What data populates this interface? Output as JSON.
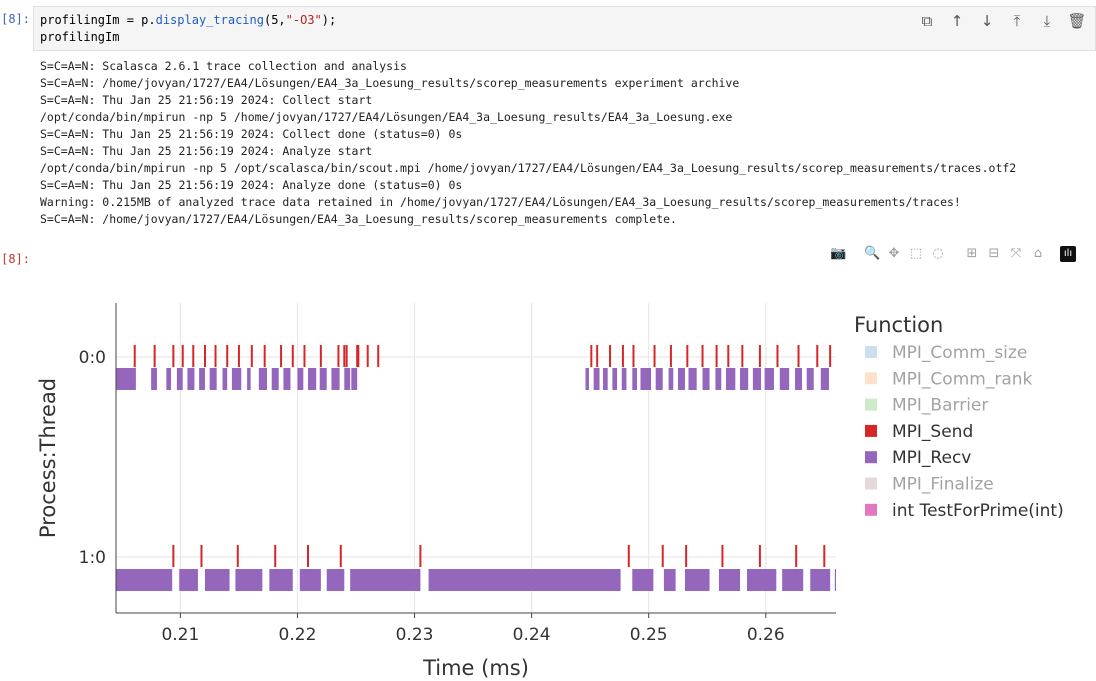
{
  "cell": {
    "in_prompt": "[8]:",
    "out_prompt": "[8]:",
    "code_line1_a": "profilingIm = p.",
    "code_line1_fn": "display_tracing",
    "code_line1_b": "(5,",
    "code_line1_str": "\"-O3\"",
    "code_line1_c": ");",
    "code_line2": "profilingIm"
  },
  "toolbar": {
    "copy_icon": "⧉",
    "move_up_icon": "↑",
    "move_down_icon": "↓",
    "insert_above_icon": "⤒",
    "insert_below_icon": "⤓",
    "delete_icon": "🗑"
  },
  "output_lines": [
    "S=C=A=N: Scalasca 2.6.1 trace collection and analysis",
    "S=C=A=N: /home/jovyan/1727/EA4/Lösungen/EA4_3a_Loesung_results/scorep_measurements experiment archive",
    "S=C=A=N: Thu Jan 25 21:56:19 2024: Collect start",
    "/opt/conda/bin/mpirun -np 5 /home/jovyan/1727/EA4/Lösungen/EA4_3a_Loesung_results/EA4_3a_Loesung.exe",
    "S=C=A=N: Thu Jan 25 21:56:19 2024: Collect done (status=0) 0s",
    "S=C=A=N: Thu Jan 25 21:56:19 2024: Analyze start",
    "/opt/conda/bin/mpirun -np 5 /opt/scalasca/bin/scout.mpi /home/jovyan/1727/EA4/Lösungen/EA4_3a_Loesung_results/scorep_measurements/traces.otf2",
    "S=C=A=N: Thu Jan 25 21:56:19 2024: Analyze done (status=0) 0s",
    "Warning: 0.215MB of analyzed trace data retained in /home/jovyan/1727/EA4/Lösungen/EA4_3a_Loesung_results/scorep_measurements/traces!",
    "S=C=A=N: /home/jovyan/1727/EA4/Lösungen/EA4_3a_Loesung_results/scorep_measurements complete."
  ],
  "modebar": {
    "camera_icon": "📷",
    "zoom_icon": "🔍",
    "pan_icon": "✥",
    "box_select_icon": "⬚",
    "lasso_icon": "◌",
    "zoom_in_icon": "⊞",
    "zoom_out_icon": "⊟",
    "autoscale_icon": "⤧",
    "reset_icon": "⌂",
    "plotly_logo": "ılı"
  },
  "chart_data": {
    "type": "timeline",
    "xlabel": "Time (ms)",
    "ylabel": "Process:Thread",
    "xlim": [
      0.2045,
      0.266
    ],
    "x_ticks": [
      0.21,
      0.22,
      0.23,
      0.24,
      0.25,
      0.26
    ],
    "x_tick_labels": [
      "0.21",
      "0.22",
      "0.23",
      "0.24",
      "0.25",
      "0.26"
    ],
    "rows": [
      "0:0",
      "1:0"
    ],
    "grid": true,
    "legend": {
      "title": "Function",
      "position": "right",
      "entries": [
        {
          "name": "MPI_Comm_size",
          "color": "#8db8dc",
          "visible": false
        },
        {
          "name": "MPI_Comm_rank",
          "color": "#ffbb88",
          "visible": false
        },
        {
          "name": "MPI_Barrier",
          "color": "#90d08a",
          "visible": false
        },
        {
          "name": "MPI_Send",
          "color": "#d62728",
          "visible": true
        },
        {
          "name": "MPI_Recv",
          "color": "#9467bd",
          "visible": true
        },
        {
          "name": "MPI_Finalize",
          "color": "#c9aba6",
          "visible": false
        },
        {
          "name": "int TestForPrime(int)",
          "color": "#e377c2",
          "visible": true
        }
      ]
    },
    "send_events": {
      "0:0": [
        0.2061,
        0.2078,
        0.2094,
        0.2102,
        0.2111,
        0.2121,
        0.213,
        0.214,
        0.215,
        0.2161,
        0.2172,
        0.2186,
        0.2196,
        0.2206,
        0.222,
        0.2235,
        0.2242,
        0.2252,
        0.226,
        0.2269,
        0.224,
        0.2251,
        0.2451,
        0.2456,
        0.2467,
        0.2478,
        0.2487,
        0.2505,
        0.2519,
        0.2533,
        0.2546,
        0.2558,
        0.2568,
        0.258,
        0.2595,
        0.261,
        0.2628,
        0.2644,
        0.2655
      ],
      "1:0": [
        0.2094,
        0.2118,
        0.2149,
        0.2181,
        0.2209,
        0.2237,
        0.2305,
        0.2483,
        0.2512,
        0.2532,
        0.2563,
        0.2595,
        0.2626,
        0.265
      ]
    },
    "recv_segments": {
      "0:0": [
        [
          0.2045,
          0.2062
        ],
        [
          0.2075,
          0.208
        ],
        [
          0.2088,
          0.2092
        ],
        [
          0.2097,
          0.2102
        ],
        [
          0.2106,
          0.2112
        ],
        [
          0.2116,
          0.2121
        ],
        [
          0.2125,
          0.2131
        ],
        [
          0.2136,
          0.214
        ],
        [
          0.2144,
          0.2152
        ],
        [
          0.2157,
          0.216
        ],
        [
          0.2167,
          0.2174
        ],
        [
          0.2178,
          0.2184
        ],
        [
          0.2188,
          0.2194
        ],
        [
          0.22,
          0.2205
        ],
        [
          0.2209,
          0.2216
        ],
        [
          0.2219,
          0.2225
        ],
        [
          0.2229,
          0.2236
        ],
        [
          0.224,
          0.2245
        ],
        [
          0.2246,
          0.2251
        ],
        [
          0.2446,
          0.2449
        ],
        [
          0.2453,
          0.2458
        ],
        [
          0.2461,
          0.2465
        ],
        [
          0.2469,
          0.2473
        ],
        [
          0.2477,
          0.2481
        ],
        [
          0.2486,
          0.249
        ],
        [
          0.2493,
          0.2502
        ],
        [
          0.2506,
          0.2512
        ],
        [
          0.2517,
          0.2521
        ],
        [
          0.2525,
          0.2531
        ],
        [
          0.2534,
          0.2541
        ],
        [
          0.2546,
          0.2552
        ],
        [
          0.2557,
          0.2562
        ],
        [
          0.2566,
          0.2574
        ],
        [
          0.2578,
          0.2585
        ],
        [
          0.2589,
          0.2596
        ],
        [
          0.2599,
          0.2607
        ],
        [
          0.2612,
          0.262
        ],
        [
          0.2625,
          0.2631
        ],
        [
          0.2635,
          0.2641
        ],
        [
          0.2647,
          0.2654
        ]
      ],
      "1:0": [
        [
          0.2045,
          0.2093
        ],
        [
          0.2099,
          0.2115
        ],
        [
          0.2121,
          0.2142
        ],
        [
          0.2147,
          0.217
        ],
        [
          0.2176,
          0.2196
        ],
        [
          0.2202,
          0.222
        ],
        [
          0.2225,
          0.224
        ],
        [
          0.2245,
          0.2305
        ],
        [
          0.2312,
          0.2476
        ],
        [
          0.2486,
          0.2504
        ],
        [
          0.2513,
          0.2523
        ],
        [
          0.2531,
          0.2552
        ],
        [
          0.256,
          0.2578
        ],
        [
          0.2584,
          0.2609
        ],
        [
          0.2614,
          0.2632
        ],
        [
          0.2638,
          0.2655
        ],
        [
          0.2659,
          0.2664
        ]
      ]
    }
  }
}
